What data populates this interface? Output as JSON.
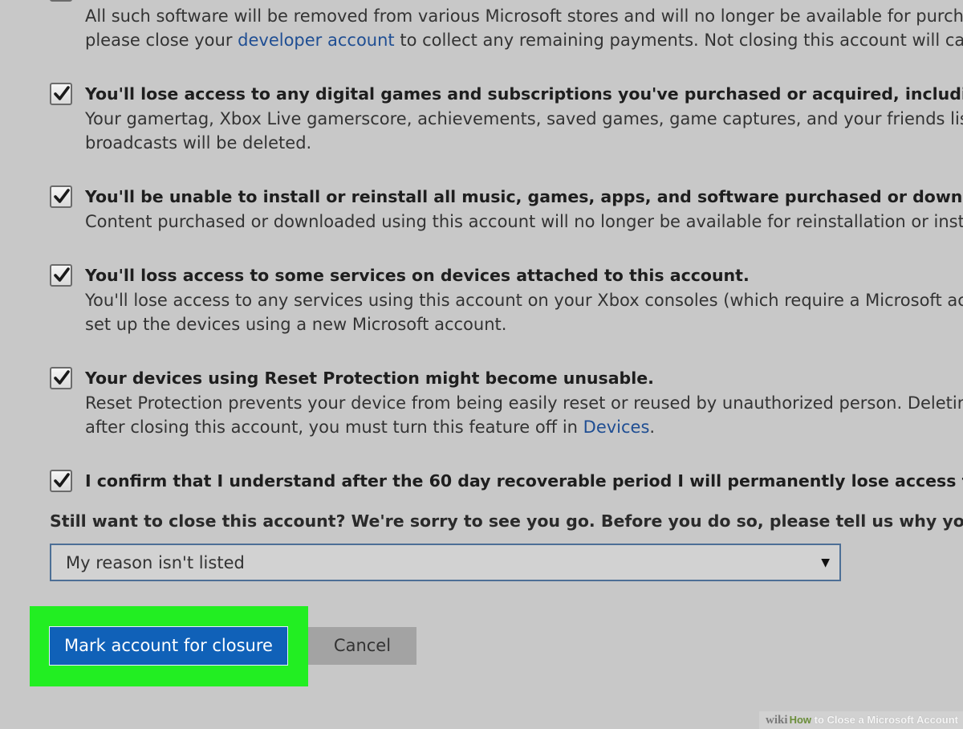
{
  "top_paragraph": {
    "line1": "All such software will be removed from various Microsoft stores and will no longer be available for purchase",
    "line2_before": "please close your ",
    "line2_link": "developer account",
    "line2_after": " to collect any remaining payments. Not closing this account will cause"
  },
  "items": [
    {
      "checked": true,
      "heading": "You'll lose access to any digital games and subscriptions you've purchased or acquired, including Xbox Li",
      "line1": "Your gamertag, Xbox Live gamerscore, achievements, saved games, game captures, and your friends list will",
      "line2": "broadcasts will be deleted."
    },
    {
      "checked": true,
      "heading": "You'll be unable to install or reinstall all music, games, apps, and software purchased or downloaded usin",
      "line1": "Content purchased or downloaded using this account will no longer be available for reinstallation or installa"
    },
    {
      "checked": true,
      "heading": "You'll loss access to some services on devices attached to this account.",
      "line1": "You'll lose access to any services using this account on your Xbox consoles (which require a Microsoft accou",
      "line2": "set up the devices using a new Microsoft account."
    },
    {
      "checked": true,
      "heading": "Your devices using Reset Protection might become unusable.",
      "line1": "Reset Protection prevents your device from being easily reset or reused by unauthorized person. Deleting yo",
      "line2_before": "after closing this account, you must turn this feature off in ",
      "line2_link": "Devices",
      "line2_after": "."
    },
    {
      "checked": true,
      "heading": "I confirm that I understand after the 60 day recoverable period I will permanently lose access to sites, ser"
    }
  ],
  "question": "Still want to close this account? We're sorry to see you go. Before you do so, please tell us why you're leaving",
  "reason_select": {
    "value": "My reason isn't listed",
    "arrow": "▼"
  },
  "buttons": {
    "primary_label": "Mark account for closure",
    "cancel_label": "Cancel"
  },
  "highlight_color": "#22ee22",
  "accent_color": "#1061b8",
  "link_color": "#1f4e93",
  "watermark": {
    "wiki": "wiki",
    "how": "How",
    "rest": " to Close a Microsoft Account"
  },
  "icons": {
    "checkbox": "checkmark-icon",
    "dropdown": "dropdown-arrow-icon"
  }
}
